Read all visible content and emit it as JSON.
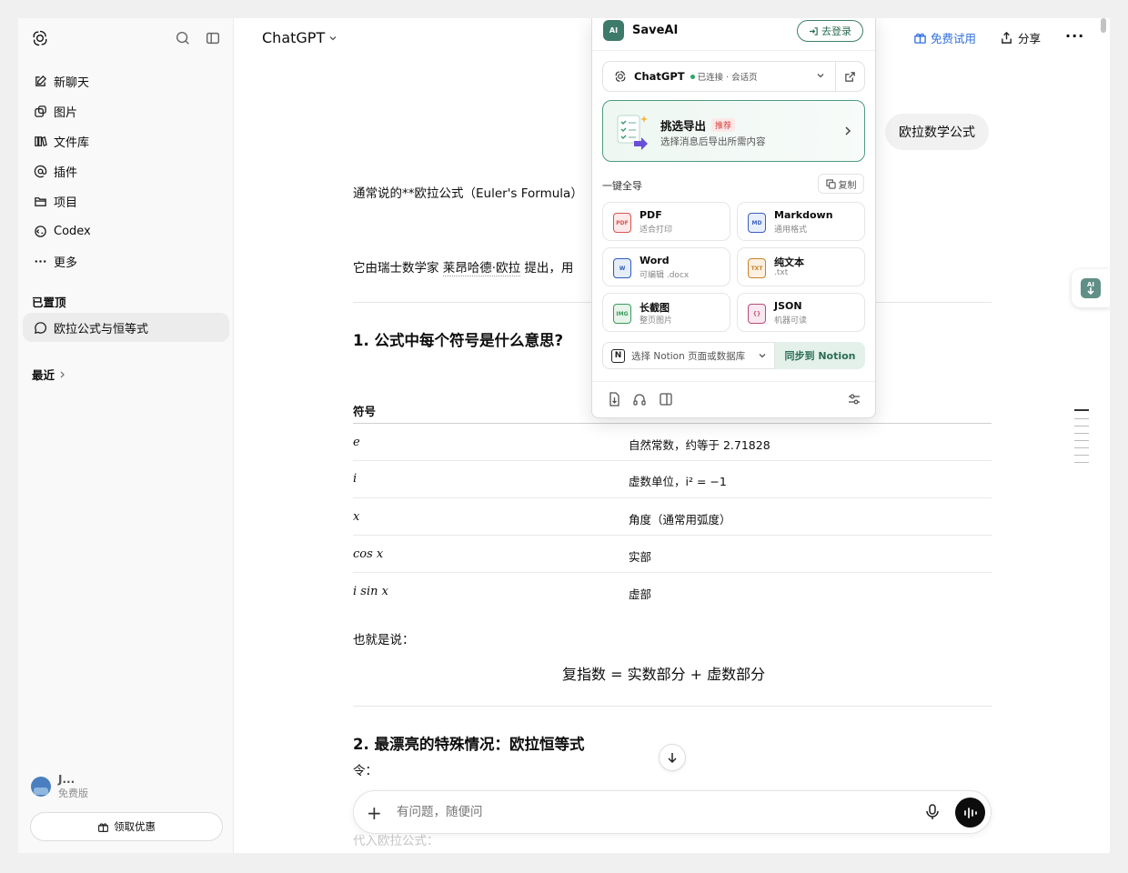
{
  "sidebar": {
    "new_chat": "新聊天",
    "images": "图片",
    "library": "文件库",
    "plugins": "插件",
    "projects": "项目",
    "codex": "Codex",
    "more": "更多",
    "pinned_heading": "已置顶",
    "pinned_chat": "欧拉公式与恒等式",
    "recent_heading": "最近",
    "user_name": "J...",
    "user_plan": "免费版",
    "promo_label": "领取优惠"
  },
  "header": {
    "model": "ChatGPT",
    "trial_label": "免费试用",
    "share_label": "分享",
    "more_label": "···"
  },
  "chat": {
    "user_message": "欧拉数学公式",
    "para1": "通常说的**欧拉公式（Euler's Formula）",
    "para2_prefix": "它由瑞士数学家 ",
    "para2_name": "莱昂哈德·欧拉",
    "para2_suffix": " 提出，用",
    "heading1": "1. 公式中每个符号是什么意思?",
    "table_header": "符号",
    "table_rows": [
      {
        "symbol": "e",
        "meaning": "自然常数，约等于 2.71828"
      },
      {
        "symbol": "i",
        "meaning": "虚数单位，i² = −1"
      },
      {
        "symbol": "x",
        "meaning": "角度（通常用弧度）"
      },
      {
        "symbol": "cos x",
        "meaning": "实部"
      },
      {
        "symbol": "i sin x",
        "meaning": "虚部"
      }
    ],
    "also_said": "也就是说：",
    "formula": "复指数 = 实数部分 + 虚数部分",
    "heading2": "2. 最漂亮的特殊情况：欧拉恒等式",
    "let_label": "令：",
    "faded": "代入欧拉公式："
  },
  "composer": {
    "placeholder": "有问题，随便问"
  },
  "saveai": {
    "title": "SaveAI",
    "logo_text": "AI",
    "login_label": "去登录",
    "source_name": "ChatGPT",
    "source_status": "已连接 · 会话页",
    "pick_title": "挑选导出",
    "pick_badge": "推荐",
    "pick_sub": "选择消息后导出所需内容",
    "onekey_label": "一键全导",
    "copy_label": "复制",
    "formats": [
      {
        "name": "PDF",
        "sub": "适合打印",
        "icon": "PDF",
        "color": "#d9534f",
        "bg": "#fdeaea"
      },
      {
        "name": "Markdown",
        "sub": "通用格式",
        "icon": "MD",
        "color": "#3b5fc0",
        "bg": "#e8eefb"
      },
      {
        "name": "Word",
        "sub": "可编辑 .docx",
        "icon": "W",
        "color": "#2c5bb8",
        "bg": "#e6edf9"
      },
      {
        "name": "纯文本",
        "sub": ".txt",
        "icon": "TXT",
        "color": "#c9822a",
        "bg": "#fbf0e2"
      },
      {
        "name": "长截图",
        "sub": "整页图片",
        "icon": "IMG",
        "color": "#3a9a5b",
        "bg": "#e6f4ea"
      },
      {
        "name": "JSON",
        "sub": "机器可读",
        "icon": "{}",
        "color": "#b94a7a",
        "bg": "#f8e8ef"
      }
    ],
    "notion_placeholder": "选择 Notion 页面或数据库",
    "notion_sync": "同步到 Notion"
  }
}
